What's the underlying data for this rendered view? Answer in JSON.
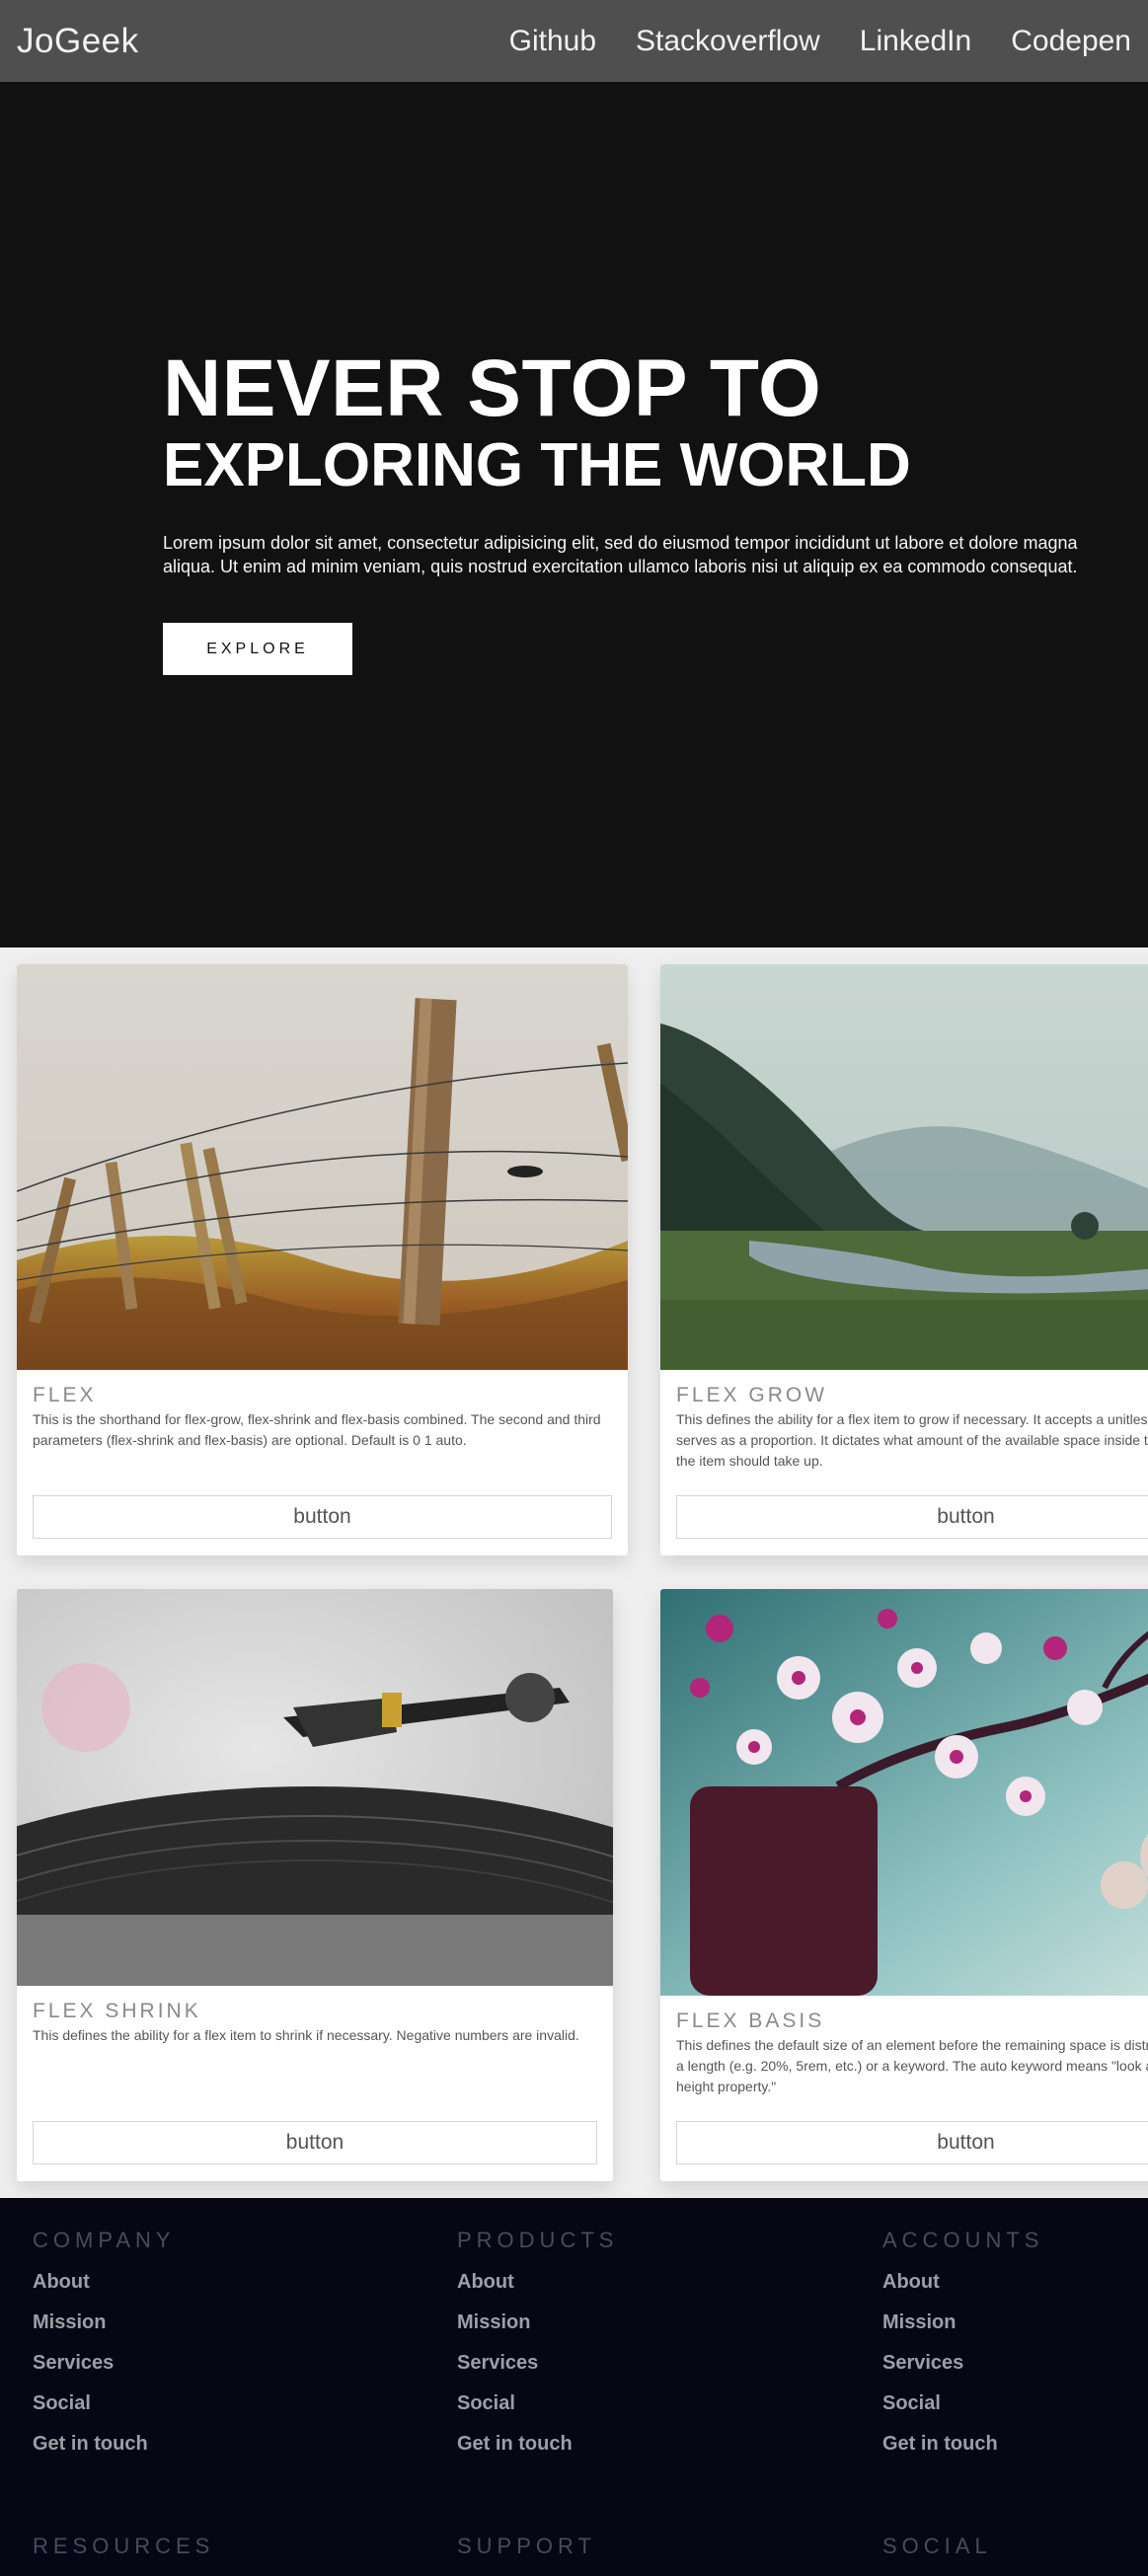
{
  "header": {
    "brand": "JoGeek",
    "nav": [
      "Github",
      "Stackoverflow",
      "LinkedIn",
      "Codepen"
    ]
  },
  "hero": {
    "title_line1": "NEVER STOP TO",
    "title_line2": "EXPLORING THE WORLD",
    "text": "Lorem ipsum dolor sit amet, consectetur adipisicing elit, sed do eiusmod tempor incididunt ut labore et dolore magna aliqua. Ut enim ad minim veniam, quis nostrud exercitation ullamco laboris nisi ut aliquip ex ea commodo consequat.",
    "button": "EXPLORE"
  },
  "cards": [
    {
      "title": "FLEX",
      "desc": "This is the shorthand for flex-grow, flex-shrink and flex-basis combined. The second and third parameters (flex-shrink and flex-basis) are optional. Default is 0 1 auto.",
      "button": "button",
      "image": "barbed-wire-fence"
    },
    {
      "title": "FLEX GROW",
      "desc": "This defines the ability for a flex item to grow if necessary. It accepts a unitless value that serves as a proportion. It dictates what amount of the available space inside the flex container the item should take up.",
      "button": "button",
      "image": "misty-river-valley"
    },
    {
      "title": "FLEX SHRINK",
      "desc": "This defines the ability for a flex item to shrink if necessary. Negative numbers are invalid.",
      "button": "button",
      "image": "record-player"
    },
    {
      "title": "FLEX BASIS",
      "desc": "This defines the default size of an element before the remaining space is distributed. It can be a length (e.g. 20%, 5rem, etc.) or a keyword. The auto keyword means \"look at my width or height property.\"",
      "button": "button",
      "image": "cherry-blossoms"
    }
  ],
  "footer": {
    "columns": [
      {
        "heading": "COMPANY",
        "links": [
          "About",
          "Mission",
          "Services",
          "Social",
          "Get in touch"
        ]
      },
      {
        "heading": "PRODUCTS",
        "links": [
          "About",
          "Mission",
          "Services",
          "Social",
          "Get in touch"
        ]
      },
      {
        "heading": "ACCOUNTS",
        "links": [
          "About",
          "Mission",
          "Services",
          "Social",
          "Get in touch"
        ]
      }
    ],
    "second_row": [
      "RESOURCES",
      "SUPPORT",
      "SOCIAL"
    ]
  }
}
